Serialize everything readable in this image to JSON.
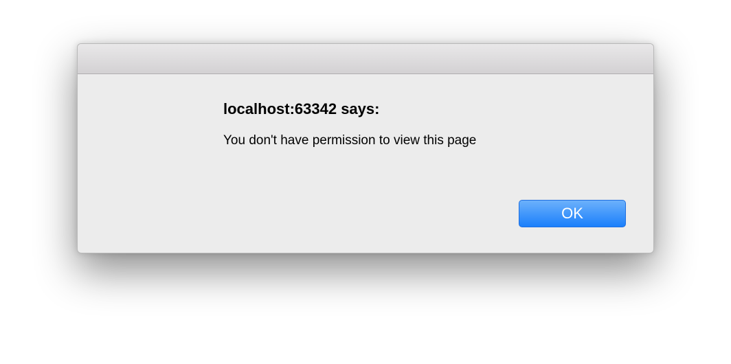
{
  "dialog": {
    "title": "localhost:63342 says:",
    "message": "You don't have permission to view this page",
    "ok_label": "OK",
    "accent": "#1a7ffb"
  }
}
